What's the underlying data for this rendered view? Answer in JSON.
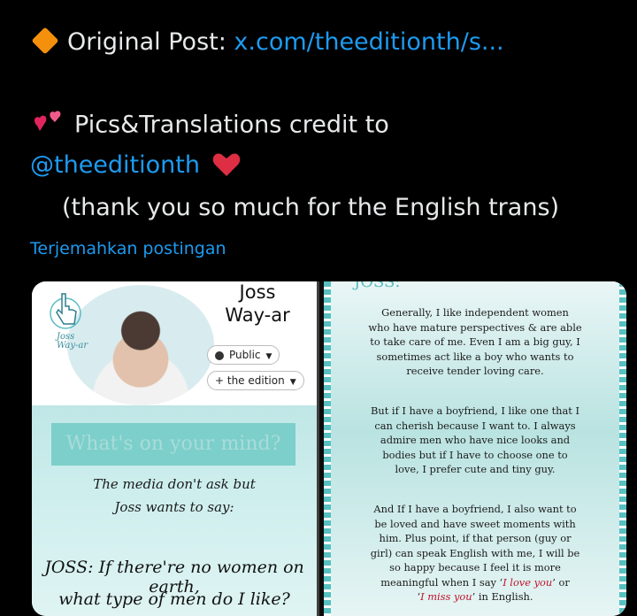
{
  "post": {
    "line1_label": "Original Post: ",
    "line1_link": "x.com/theeditionth/s...",
    "credit_text": "Pics&Translations credit to",
    "credit_handle": "@theeditionth",
    "thanks": "(thank you so much for the English trans)",
    "translate": "Terjemahkan postingan"
  },
  "icons": {
    "bullet": "orange-diamond-icon",
    "hearts": "two-hearts-icon",
    "heart": "red-heart-icon"
  },
  "colors": {
    "link": "#1d9bf0",
    "background": "#000000",
    "text": "#e7e9ea",
    "heart": "#e0245e",
    "teal": "#7ccfcb"
  },
  "image_left": {
    "name_line1": "Joss",
    "name_line2": "Way-ar",
    "public_pill": "Public",
    "edition_pill": "+ the edition",
    "mind_prompt": "What's on your mind?",
    "subtitle_line1": "The media don't ask but",
    "subtitle_line2": "Joss wants to say:",
    "question_line1": "JOSS: If there're no women on earth,",
    "question_line2": "what type of men do I like?"
  },
  "image_right": {
    "heading": "JOSS:",
    "para1": [
      "Generally, I like independent women",
      "who have mature perspectives & are able",
      "to take care of me. Even I am a big guy, I",
      "sometimes act like a boy who wants to",
      "receive tender loving care."
    ],
    "para2": [
      "But if I have a boyfriend, I like one that I",
      "can cherish because I want to. I always",
      "admire men who have nice looks and",
      "bodies but if I have to choose one to",
      "love, I prefer cute and tiny guy."
    ],
    "para3": [
      "And If I have a boyfriend, I also want to",
      "be loved and have sweet moments with",
      "him. Plus point, if that person (guy or",
      "girl) can speak English with me, I will be",
      "so happy because I feel it is more"
    ],
    "para3_end_prefix": "meaningful when I say ‘",
    "love_phrase": "I love you",
    "para3_end_suffix": "’ or",
    "miss_prefix": "‘",
    "miss_phrase": "I miss you",
    "miss_suffix": "’ in English."
  }
}
